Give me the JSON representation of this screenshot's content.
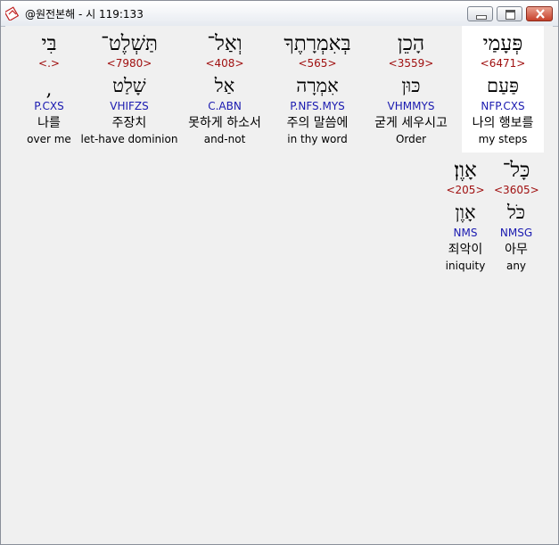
{
  "window": {
    "title": "@원전본해 - 시 119:133",
    "controls": [
      "minimize",
      "maximize",
      "close"
    ]
  },
  "colors": {
    "strong_number": "#a01010",
    "parsing": "#1a1ab0",
    "selected_background": "#ffffff"
  },
  "words": [
    {
      "hebrew": "פְּעָמַי",
      "strong": "<6471>",
      "lemma": "פַּעַם",
      "parsing": "NFP.CXS",
      "korean": "나의 행보를",
      "english": "my steps"
    },
    {
      "hebrew": "הָכֵן",
      "strong": "<3559>",
      "lemma": "כּוּן",
      "parsing": "VHMMYS",
      "korean": "굳게 세우시고",
      "english": "Order"
    },
    {
      "hebrew": "בְּאִמְרָתֶךָ",
      "strong": "<565>",
      "lemma": "אִמְרָה",
      "parsing": "P.NFS.MYS",
      "korean": "주의 말씀에",
      "english": "in thy word"
    },
    {
      "hebrew": "וְאַל־",
      "strong": "<408>",
      "lemma": "אַל",
      "parsing": "C.ABN",
      "korean": "못하게 하소서",
      "english": "and-not"
    },
    {
      "hebrew": "תַּשְׁלֶט־",
      "strong": "<7980>",
      "lemma": "שָׁלַט",
      "parsing": "VHIFZS",
      "korean": "주장치",
      "english": "let-have dominion"
    },
    {
      "hebrew": "בִּי",
      "strong": "<.>",
      "lemma": ",",
      "parsing": "P.CXS",
      "korean": "나를",
      "english": "over me"
    },
    {
      "hebrew": "כָּל־",
      "strong": "<3605>",
      "lemma": "כֹּל",
      "parsing": "NMSG",
      "korean": "아무",
      "english": "any"
    },
    {
      "hebrew": "אָוֶן׃",
      "strong": "<205>",
      "lemma": "אָוֶן",
      "parsing": "NMS",
      "korean": "죄악이",
      "english": "iniquity"
    }
  ]
}
